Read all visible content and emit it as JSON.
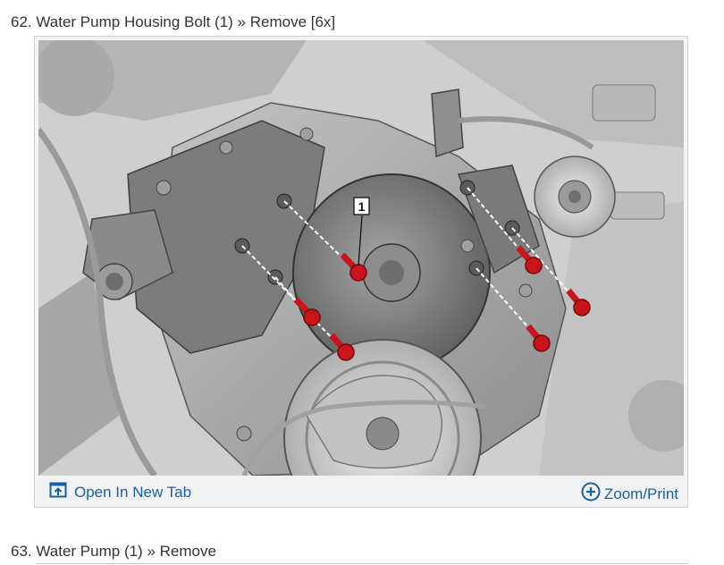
{
  "steps": [
    {
      "number": "62.",
      "title": "Water Pump Housing Bolt (1) » Remove [6x]"
    },
    {
      "number": "63.",
      "title": "Water Pump (1) » Remove"
    }
  ],
  "figure": {
    "callout": "1",
    "toolbar": {
      "open_label": "Open In New Tab",
      "open_icon": "open-in-new-tab-icon",
      "zoom_label": "Zoom/Print",
      "zoom_icon": "zoom-plus-icon"
    }
  },
  "colors": {
    "link": "#1b5fa3",
    "bolt": "#c8141a",
    "text": "#333333"
  }
}
